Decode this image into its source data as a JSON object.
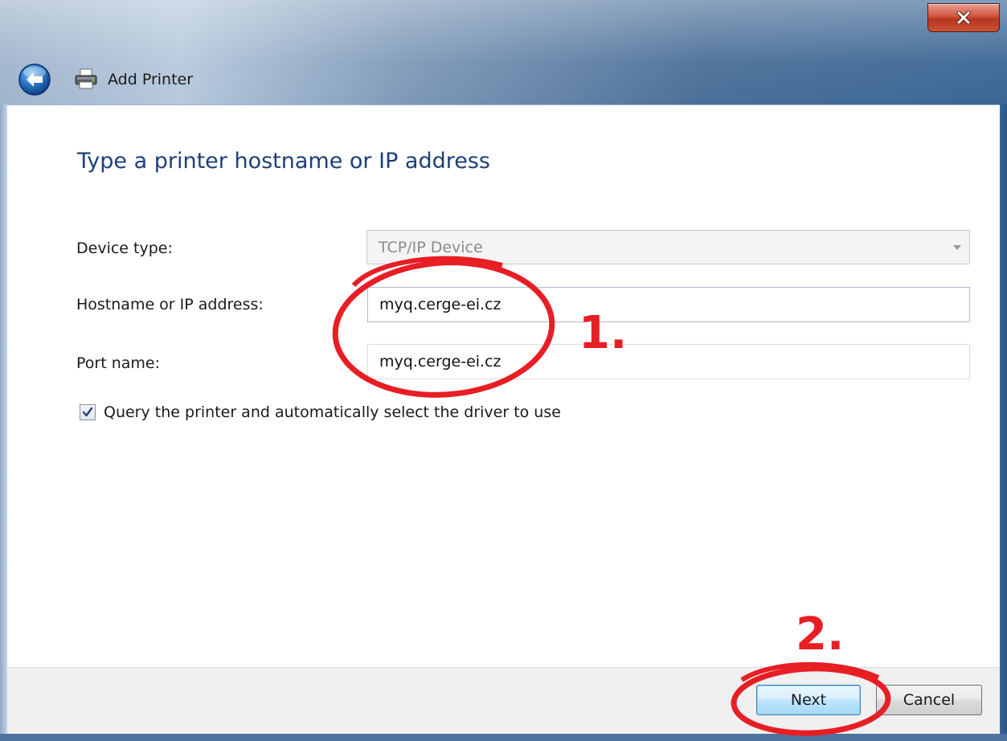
{
  "window": {
    "title": "Add Printer",
    "close_glyph": "x"
  },
  "page": {
    "heading": "Type a printer hostname or IP address"
  },
  "form": {
    "device_type": {
      "label": "Device type:",
      "value": "TCP/IP Device"
    },
    "hostname": {
      "label": "Hostname or IP address:",
      "value": "myq.cerge-ei.cz"
    },
    "port": {
      "label": "Port name:",
      "value": "myq.cerge-ei.cz"
    },
    "query_checkbox": {
      "label": "Query the printer and automatically select the driver to use",
      "checked": true
    }
  },
  "footer": {
    "next_label": "Next",
    "cancel_label": "Cancel"
  },
  "annotations": {
    "step1": "1.",
    "step2": "2.",
    "circle_color": "#e81e25"
  },
  "icons": [
    "close-icon",
    "back-arrow-icon",
    "printer-icon",
    "dropdown-arrow-icon",
    "checkmark-icon"
  ]
}
